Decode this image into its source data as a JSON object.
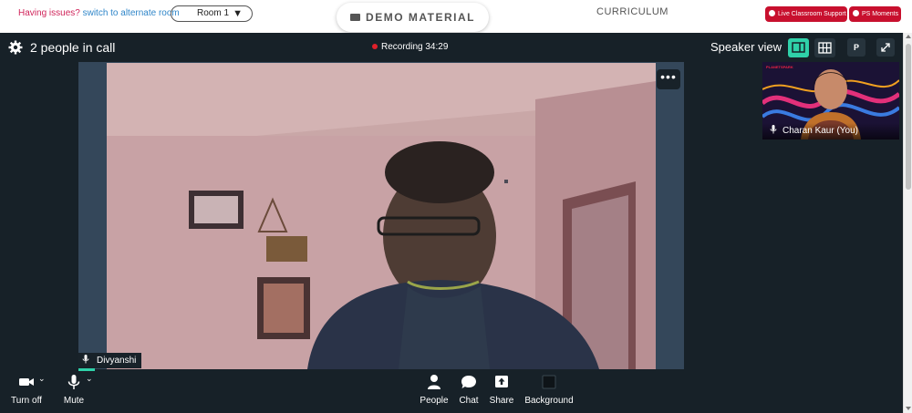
{
  "topbar": {
    "issues_prefix": "Having issues?",
    "issues_link": "switch to alternate room",
    "room_selected": "Room 1",
    "demo_material": "DEMO MATERIAL",
    "curriculum": "CURRICULUM",
    "live_support": "Live Classroom Support",
    "ps_moments": "PS Moments"
  },
  "call": {
    "people_count": "2 people in call",
    "recording": "Recording 34:29",
    "view_mode": "Speaker view",
    "p_button": "P",
    "more_button": "•••",
    "main_participant": "Divyanshi",
    "self_participant": "Charan Kaur (You)"
  },
  "controls": {
    "camera": "Turn off",
    "mic": "Mute",
    "people": "People",
    "chat": "Chat",
    "share": "Share",
    "background": "Background"
  },
  "colors": {
    "accent": "#2fd1a9",
    "call_bg": "#172128",
    "stage_bg": "#34475a",
    "recording_dot": "#e0202a",
    "pill_red": "#c8102e"
  },
  "icons": {
    "settings": "gear-icon",
    "speaker_view": "speaker-layout-icon",
    "grid_view": "grid-layout-icon",
    "fullscreen": "expand-icon",
    "camera": "video-camera-icon",
    "mic": "microphone-icon",
    "people": "person-icon",
    "chat": "chat-bubble-icon",
    "share": "screen-share-icon",
    "background": "background-icon"
  }
}
